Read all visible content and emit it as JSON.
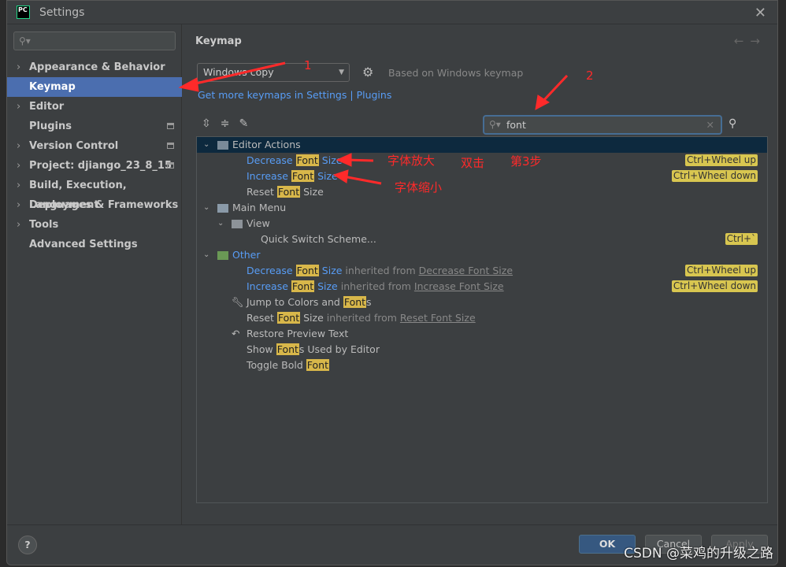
{
  "window": {
    "title": "Settings",
    "logo": "PC"
  },
  "sidebar": {
    "search_placeholder": "",
    "items": [
      {
        "label": "Appearance & Behavior",
        "expandable": true
      },
      {
        "label": "Keymap",
        "selected": true
      },
      {
        "label": "Editor",
        "expandable": true
      },
      {
        "label": "Plugins",
        "badge": true
      },
      {
        "label": "Version Control",
        "expandable": true,
        "badge": true
      },
      {
        "label": "Project: djiango_23_8_15",
        "expandable": true,
        "badge": true
      },
      {
        "label": "Build, Execution, Deployment",
        "expandable": true
      },
      {
        "label": "Languages & Frameworks",
        "expandable": true
      },
      {
        "label": "Tools",
        "expandable": true
      },
      {
        "label": "Advanced Settings"
      }
    ]
  },
  "main": {
    "title": "Keymap",
    "keymap": "Windows copy",
    "based_on": "Based on Windows keymap",
    "link_settings": "Get more keymaps in Settings",
    "link_sep": " | ",
    "link_plugins": "Plugins",
    "search": "font",
    "tree": {
      "editor_actions": "Editor Actions",
      "main_menu": "Main Menu",
      "view": "View",
      "other": "Other",
      "inherited": " inherited from ",
      "decrease": "Decrease",
      "increase": "Increase",
      "reset": "Reset",
      "font": "Font",
      "size": " Size",
      "sc_up": "Ctrl+Wheel up",
      "sc_down": "Ctrl+Wheel down",
      "sc_quick": "Ctrl+`",
      "quick_switch": "Quick Switch Scheme...",
      "decrease_full": "Decrease Font Size",
      "increase_full": "Increase Font Size",
      "reset_full": "Reset Font Size",
      "jump_pre": "Jump to Colors and ",
      "fonts_s": "s",
      "restore": "Restore Preview Text",
      "show_pre": "Show ",
      "show_post": "s Used by Editor",
      "toggle_pre": "Toggle Bold "
    }
  },
  "footer": {
    "help": "?",
    "ok": "OK",
    "cancel": "Cancel",
    "apply": "Apply"
  },
  "annotations": {
    "n1": "1",
    "n2": "2",
    "enlarge": "字体放大",
    "double_click": "双击",
    "step3": "第3步",
    "shrink": "字体缩小",
    "color": "#ff2a2a"
  },
  "watermark": "CSDN @菜鸡的升级之路"
}
